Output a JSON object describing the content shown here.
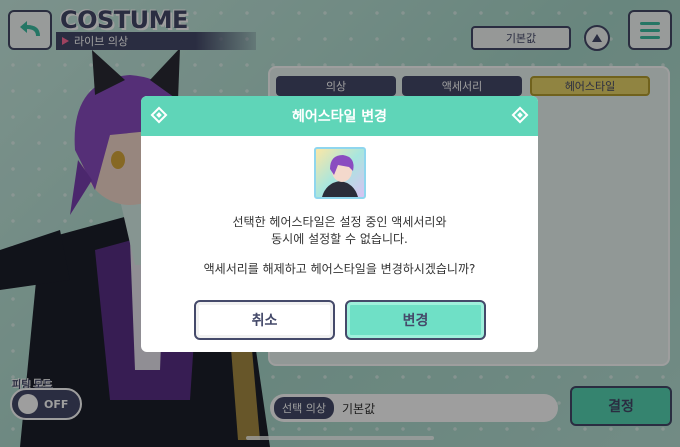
{
  "header": {
    "title": "COSTUME",
    "subtitle": "라이브 의상",
    "default_button": "기본값"
  },
  "tabs": [
    {
      "label": "의상",
      "active": false
    },
    {
      "label": "액세서리",
      "active": false
    },
    {
      "label": "헤어스타일",
      "active": true
    }
  ],
  "footer": {
    "fitting_mode_label": "피팅 모드",
    "fitting_toggle_state": "OFF",
    "selected_outfit_label": "선택 의상",
    "selected_outfit_value": "기본값",
    "decide_button": "결정"
  },
  "modal": {
    "title": "헤어스타일 변경",
    "message_line1": "선택한 헤어스타일은 설정 중인 액세서리와",
    "message_line2": "동시에 설정할 수 없습니다.",
    "message_line3": "액세서리를 해제하고 헤어스타일을 변경하시겠습니까?",
    "cancel_button": "취소",
    "confirm_button": "변경"
  },
  "colors": {
    "accent": "#5fd5b8",
    "navy": "#454a6a",
    "active_tab": "#e8d56a"
  }
}
